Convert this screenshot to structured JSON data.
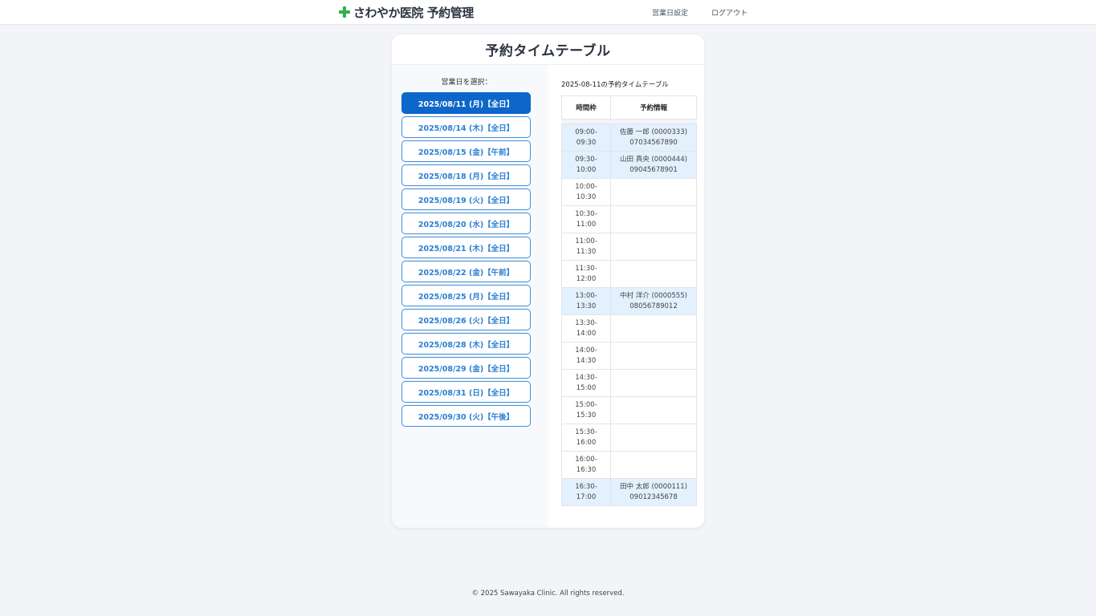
{
  "header": {
    "brand": "さわやか医院 予約管理",
    "nav_settings": "営業日設定",
    "nav_logout": "ログアウト"
  },
  "card": {
    "title": "予約タイムテーブル",
    "select_label": "営業日を選択：",
    "dates": [
      "2025/08/11 (月)【全日】",
      "2025/08/14 (木)【全日】",
      "2025/08/15 (金)【午前】",
      "2025/08/18 (月)【全日】",
      "2025/08/19 (火)【全日】",
      "2025/08/20 (水)【全日】",
      "2025/08/21 (木)【全日】",
      "2025/08/22 (金)【午前】",
      "2025/08/25 (月)【全日】",
      "2025/08/26 (火)【全日】",
      "2025/08/28 (木)【全日】",
      "2025/08/29 (金)【全日】",
      "2025/08/31 (日)【全日】",
      "2025/09/30 (火)【午後】"
    ],
    "selected_index": 0,
    "timetable_caption": "2025-08-11の予約タイムテーブル",
    "columns": [
      "時間枠",
      "予約情報"
    ],
    "rows": [
      {
        "start": "09:00-",
        "end": "09:30",
        "name": "佐藤 一郎 (0000333)",
        "phone": "07034567890"
      },
      {
        "start": "09:30-",
        "end": "10:00",
        "name": "山田 真央 (0000444)",
        "phone": "09045678901"
      },
      {
        "start": "10:00-",
        "end": "10:30",
        "name": "",
        "phone": ""
      },
      {
        "start": "10:30-",
        "end": "11:00",
        "name": "",
        "phone": ""
      },
      {
        "start": "11:00-",
        "end": "11:30",
        "name": "",
        "phone": ""
      },
      {
        "start": "11:30-",
        "end": "12:00",
        "name": "",
        "phone": ""
      },
      {
        "start": "13:00-",
        "end": "13:30",
        "name": "中村 洋介 (0000555)",
        "phone": "08056789012"
      },
      {
        "start": "13:30-",
        "end": "14:00",
        "name": "",
        "phone": ""
      },
      {
        "start": "14:00-",
        "end": "14:30",
        "name": "",
        "phone": ""
      },
      {
        "start": "14:30-",
        "end": "15:00",
        "name": "",
        "phone": ""
      },
      {
        "start": "15:00-",
        "end": "15:30",
        "name": "",
        "phone": ""
      },
      {
        "start": "15:30-",
        "end": "16:00",
        "name": "",
        "phone": ""
      },
      {
        "start": "16:00-",
        "end": "16:30",
        "name": "",
        "phone": ""
      },
      {
        "start": "16:30-",
        "end": "17:00",
        "name": "田中 太郎 (0000111)",
        "phone": "09012345678"
      }
    ]
  },
  "footer": {
    "copyright": "© 2025 Sawayaka Clinic. All rights reserved."
  },
  "icons": {
    "brand_icon": "plus-icon"
  },
  "colors": {
    "accent": "#0d66c9",
    "brand_plus": "#2cb34a",
    "booked_row": "#e3f0fd"
  }
}
